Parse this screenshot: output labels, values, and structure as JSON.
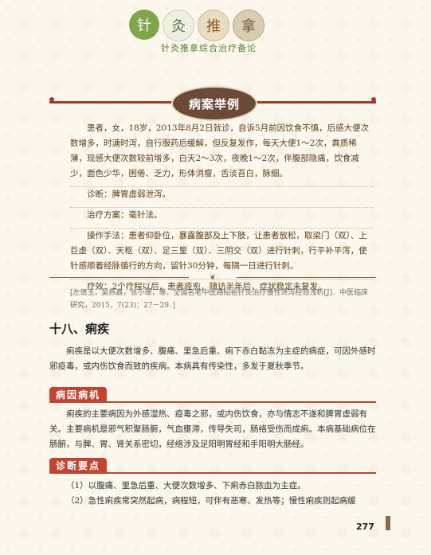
{
  "header": {
    "logo_glyphs": [
      "针",
      "灸",
      "推",
      "拿"
    ],
    "title": "针灸推拿综合治疗备论"
  },
  "case": {
    "badge": "病案举例",
    "para1": "患者，女，18岁，2013年8月2日就诊，自诉5月前因饮食不慎，后感大便次数增多，时溏时泻，自行服药后缓解，但反复发作，每天大便1～2次，粪质稀薄，现感大便次数较前增多，白天2～3次，夜晚1～2次，伴腹部隐痛，饮食减少，面色少华，困倦、乏力，形体消瘦，舌淡苔白，脉细。",
    "diagnosis": "诊断：脾胃虚弱泄泻。",
    "plan": "治疗方案：毫针法。",
    "procedure": "操作手法：患者仰卧位，暴露腹部及上下肢，让患者放松，取梁门（双）、上巨虚（双）、天枢（双）、足三里（双）、三阴交（双）进行针刺，行平补平泻，使针感顺着经脉循行的方向，留针30分钟，每隔一日进行针刺。",
    "effect": "疗效：2个疗程以后，患者痊愈，随访半年后，症状稳定未复发。"
  },
  "ornament_glyph": "❦",
  "reference": "[左倩玉，吴燕鑫，张小珊，等．全国名老中医路绍祖针灸治疗慢性泄泻经验浅析[J]．中医临床研究，2015，7(23)：27－29．]",
  "section": {
    "title": "十八、痢疾",
    "intro": "痢疾是以大便次数增多、腹痛、里急后重、痢下赤白黏冻为主症的病症，可因外感时邪疫毒，或内伤饮食而致的疾病。本病具有传染性，多发于夏秋季节。",
    "cause_head": "病因病机",
    "cause": "痢疾的主要病因为外感湿热、疫毒之邪，或内伤饮食，亦与情志不遂和脾胃虚弱有关。主要病机是邪气积聚肠腑，气血壅滞，传导失司，肠络受伤而成痢。本病基础病位在肠腑，与脾、胃、肾关系密切，经络涉及足阳明胃经和手阳明大肠经。",
    "diag_head": "诊断要点",
    "diag1": "（1）以腹痛、里急后重、大便次数增多、下痢赤白脓血为主症。",
    "diag2": "（2）急性痢疾常突然起病，病程短，可伴有恶寒、发热等；慢性痢疾则起病缓"
  },
  "page_number": "277"
}
